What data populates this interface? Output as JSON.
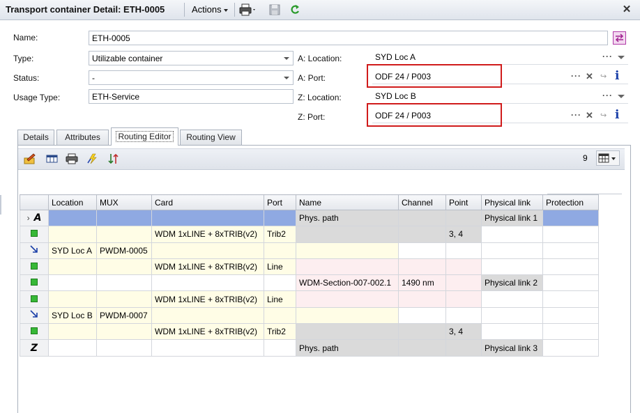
{
  "window": {
    "title": "Transport container Detail: ETH-0005",
    "actions_label": "Actions",
    "close_icon": "close-icon"
  },
  "form": {
    "name_label": "Name:",
    "name_value": "ETH-0005",
    "type_label": "Type:",
    "type_value": "Utilizable container",
    "status_label": "Status:",
    "status_value": "-",
    "usage_type_label": "Usage Type:",
    "usage_type_value": "ETH-Service",
    "a_location_label": "A: Location:",
    "a_location_value": "SYD Loc A",
    "a_port_label": "A: Port:",
    "a_port_value": "ODF 24 / P003",
    "z_location_label": "Z: Location:",
    "z_location_value": "SYD Loc B",
    "z_port_label": "Z: Port:",
    "z_port_value": "ODF 24 / P003"
  },
  "tabs": [
    {
      "label": "Details",
      "active": false
    },
    {
      "label": "Attributes",
      "active": false
    },
    {
      "label": "Routing Editor",
      "active": true
    },
    {
      "label": "Routing View",
      "active": false
    }
  ],
  "toolbar": {
    "row_count": "9"
  },
  "grid": {
    "columns": [
      "Location",
      "MUX",
      "Card",
      "Port",
      "Name",
      "Channel",
      "Point",
      "Physical link",
      "Protection"
    ],
    "rows": [
      {
        "marker": "A",
        "cells": [
          "",
          "",
          "",
          "",
          "Phys. path",
          "",
          "",
          "Physical link 1",
          ""
        ]
      },
      {
        "marker": "sq",
        "cells": [
          "",
          "",
          "WDM 1xLINE + 8xTRIB(v2)",
          "Trib2",
          "",
          "",
          "3, 4",
          "",
          ""
        ]
      },
      {
        "marker": "arrow",
        "cells": [
          "SYD Loc A",
          "PWDM-0005",
          "",
          "",
          "",
          "",
          "",
          "",
          ""
        ]
      },
      {
        "marker": "sq",
        "cells": [
          "",
          "",
          "WDM 1xLINE + 8xTRIB(v2)",
          "Line",
          "",
          "",
          "",
          "",
          ""
        ]
      },
      {
        "marker": "sq",
        "cells": [
          "",
          "",
          "",
          "",
          "WDM-Section-007-002.1",
          "1490 nm",
          "",
          "Physical link 2",
          ""
        ]
      },
      {
        "marker": "sq",
        "cells": [
          "",
          "",
          "WDM 1xLINE + 8xTRIB(v2)",
          "Line",
          "",
          "",
          "",
          "",
          ""
        ]
      },
      {
        "marker": "arrow",
        "cells": [
          "SYD Loc B",
          "PWDM-0007",
          "",
          "",
          "",
          "",
          "",
          "",
          ""
        ]
      },
      {
        "marker": "sq",
        "cells": [
          "",
          "",
          "WDM 1xLINE + 8xTRIB(v2)",
          "Trib2",
          "",
          "",
          "3, 4",
          "",
          ""
        ]
      },
      {
        "marker": "Z",
        "cells": [
          "",
          "",
          "",
          "",
          "Phys. path",
          "",
          "",
          "Physical link 3",
          ""
        ]
      }
    ]
  },
  "colors": {
    "highlight_red": "#d01b1b",
    "selected_row_blue": "#8fa9e2",
    "cell_yellow": "#fffde6",
    "cell_gray": "#dadada",
    "cell_pink": "#fdeef0",
    "status_green": "#37b837"
  }
}
